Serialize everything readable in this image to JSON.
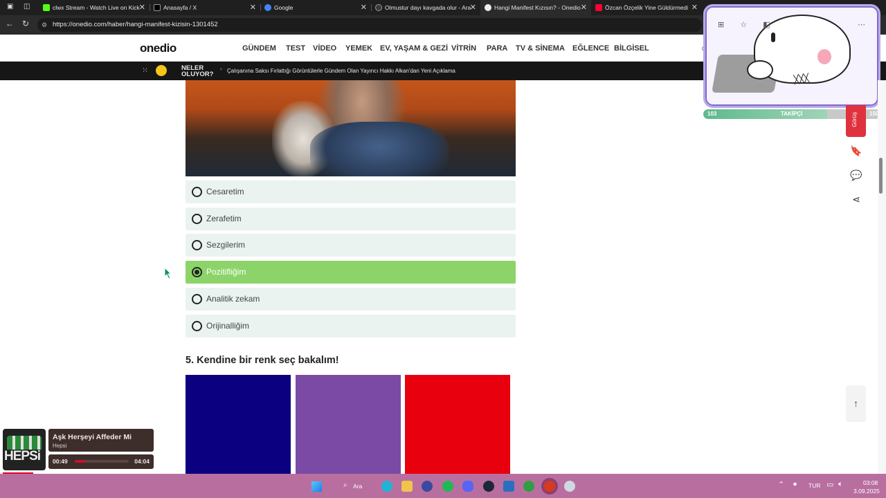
{
  "browser": {
    "tabs": [
      {
        "title": "clwx Stream - Watch Live on Kick",
        "color": "#53fc18"
      },
      {
        "title": "Anasayfa / X",
        "color": "#000000"
      },
      {
        "title": "Google",
        "color": "#4285f4"
      },
      {
        "title": "Olmustur dayı kavgada olur - Ara",
        "color": "#3a3a3a"
      },
      {
        "title": "Hangi Manifest Kızısın? - Onedio",
        "color": "#111111"
      },
      {
        "title": "Özcan Özçelik Yine Güldürmedi",
        "color": "#ff0033"
      }
    ],
    "url": "https://onedio.com/haber/hangi-manifest-kizisin-1301452"
  },
  "site": {
    "logo": "onedio",
    "nav": [
      "GÜNDEM",
      "TEST",
      "VİDEO",
      "YEMEK",
      "EV, YAŞAM & GEZİ",
      "VİTRİN",
      "PARA",
      "TV & SİNEMA",
      "EĞLENCE",
      "BİLGİSEL"
    ],
    "neler_line1": "NELER",
    "neler_line2": "OLUYOR?",
    "headline": "Çalışanına Saksı Fırlattığı Görüntülerle Gündem Olan Yayıncı Hakkı Alkan'dan Yeni Açıklama"
  },
  "quiz": {
    "options": [
      {
        "label": "Cesaretim",
        "selected": false
      },
      {
        "label": "Zerafetim",
        "selected": false
      },
      {
        "label": "Sezgilerim",
        "selected": false
      },
      {
        "label": "Pozitifliğim",
        "selected": true
      },
      {
        "label": "Analitik zekam",
        "selected": false
      },
      {
        "label": "Orijinalliğim",
        "selected": false
      }
    ],
    "question5": "5. Kendine bir renk seç bakalım!",
    "swatches": [
      "#0b0080",
      "#7b4aa4",
      "#e8000e"
    ]
  },
  "overlay": {
    "followers_left": "103",
    "followers_label": "TAKİPÇİ",
    "followers_right": "150",
    "cat_text": "╳╳╳"
  },
  "sidebar": {
    "red_tab_label": "Görüş"
  },
  "music": {
    "title": "Aşk Herşeyi Affeder Mi",
    "artist": "Hepsi",
    "elapsed": "00:49",
    "total": "04:04",
    "progress": 0.2,
    "album_text": "HEPSi"
  },
  "taskbar": {
    "search": "Ara",
    "lang": "TUR",
    "time": "03:08",
    "date": "3.09.2025"
  }
}
